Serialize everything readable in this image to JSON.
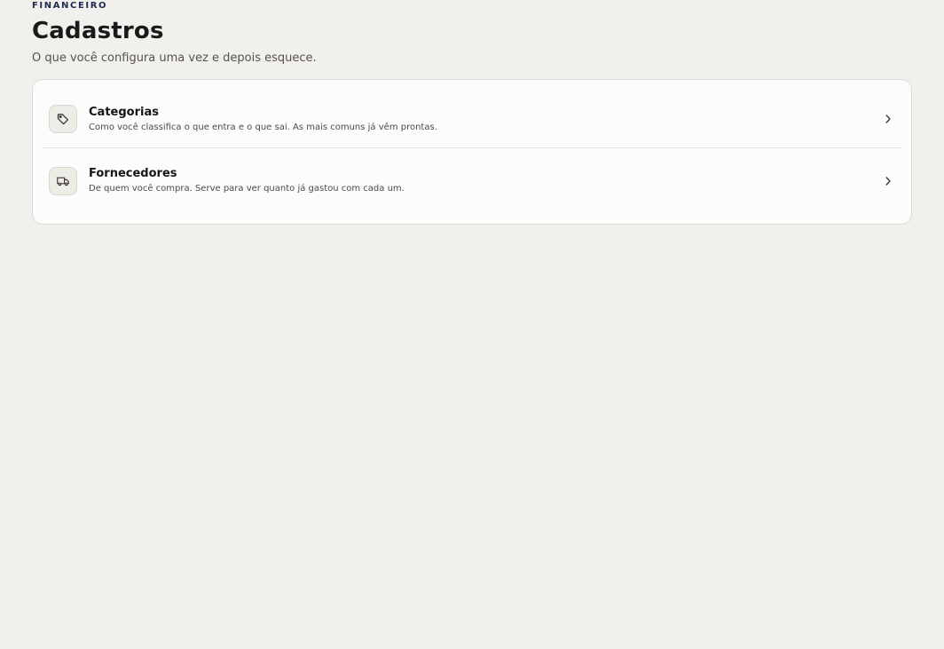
{
  "header": {
    "eyebrow": "FINANCEIRO",
    "title": "Cadastros",
    "subtitle": "O que você configura uma vez e depois esquece."
  },
  "items": [
    {
      "icon": "tag-icon",
      "title": "Categorias",
      "description": "Como você classifica o que entra e o que sai. As mais comuns já vêm prontas."
    },
    {
      "icon": "truck-icon",
      "title": "Fornecedores",
      "description": "De quem você compra. Serve para ver quanto já gastou com cada um."
    }
  ],
  "colors": {
    "background": "#f2f0ec",
    "card": "#fbfcfb",
    "eyebrow": "#1f2a4d",
    "icon_stroke": "#3d3a35"
  }
}
